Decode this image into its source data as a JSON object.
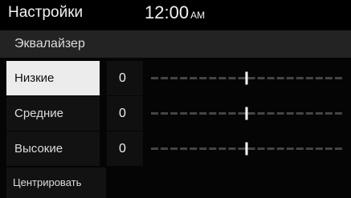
{
  "header": {
    "title": "Настройки",
    "time": "12:00",
    "ampm": "AM"
  },
  "subheader": {
    "label": "Эквалайзер"
  },
  "bands": [
    {
      "label": "Низкие",
      "value": "0",
      "selected": true
    },
    {
      "label": "Средние",
      "value": "0",
      "selected": false
    },
    {
      "label": "Высокие",
      "value": "0",
      "selected": false
    }
  ],
  "slider": {
    "min": -10,
    "max": 10
  },
  "footer": {
    "center_label": "Центрировать"
  },
  "colors": {
    "background": "#000000",
    "selected_bg": "#ececec",
    "track": "#444444",
    "thumb": "#ffffff"
  }
}
